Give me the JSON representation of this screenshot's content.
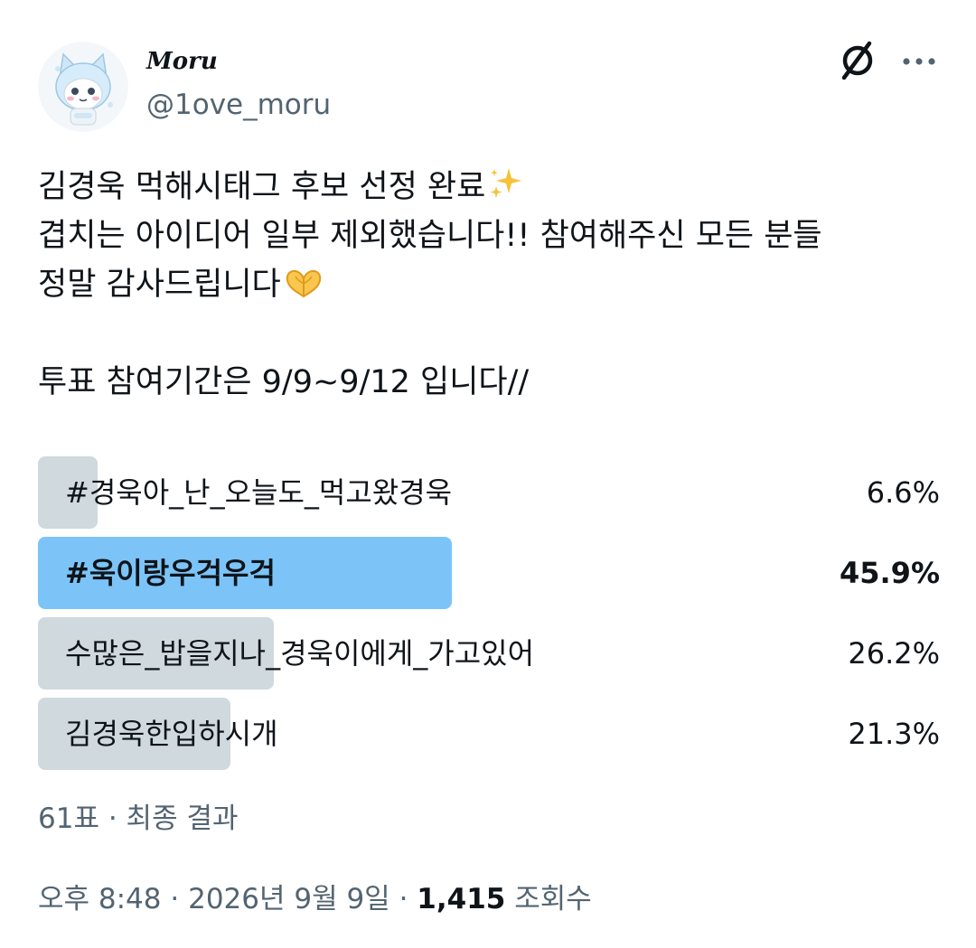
{
  "author": {
    "display_name": "Moru",
    "handle": "@1ove_moru",
    "avatar_icon": "cat-character-avatar"
  },
  "header_icons": {
    "logo": "x-logo-icon",
    "more": "more-options-icon"
  },
  "tweet": {
    "lines": [
      "김경욱 먹해시태그 후보 선정 완료",
      "겹치는 아이디어 일부 제외했습니다!! 참여해주신 모든 분들",
      "정말 감사드립니다",
      "",
      "투표 참여기간은 9/9~9/12 입니다//"
    ],
    "emoji_sparkles": "✨",
    "emoji_heart_hands": "🫶"
  },
  "poll": {
    "options": [
      {
        "label": "#경욱아_난_오늘도_먹고왔경욱",
        "percent_text": "6.6%",
        "percent": 6.6,
        "winner": false
      },
      {
        "label": "#욱이랑우걱우걱",
        "percent_text": "45.9%",
        "percent": 45.9,
        "winner": true
      },
      {
        "label": "수많은_밥을지나_경욱이에게_가고있어",
        "percent_text": "26.2%",
        "percent": 26.2,
        "winner": false
      },
      {
        "label": "김경욱한입하시개",
        "percent_text": "21.3%",
        "percent": 21.3,
        "winner": false
      }
    ],
    "votes": "61표",
    "separator": "·",
    "status": "최종 결과"
  },
  "footer": {
    "time": "오후 8:48",
    "separator": "·",
    "date": "2026년 9월 9일",
    "views_count": "1,415",
    "views_label": "조회수"
  },
  "colors": {
    "text": "#0f1419",
    "secondary": "#536471",
    "bar": "#cfd9de",
    "winner_bar": "#7cc4f7"
  }
}
